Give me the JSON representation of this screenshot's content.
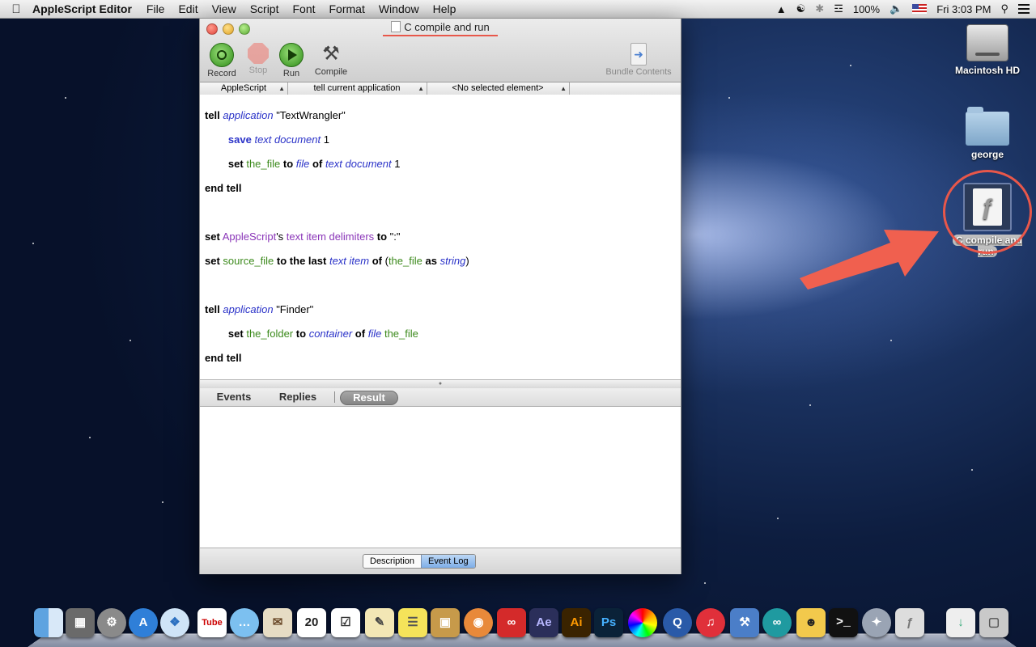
{
  "menubar": {
    "app_name": "AppleScript Editor",
    "menus": [
      "File",
      "Edit",
      "View",
      "Script",
      "Font",
      "Format",
      "Window",
      "Help"
    ],
    "battery": "100%",
    "clock": "Fri 3:03 PM"
  },
  "window": {
    "title": "C compile and run",
    "toolbar": {
      "record": "Record",
      "stop": "Stop",
      "run": "Run",
      "compile": "Compile",
      "bundle": "Bundle Contents"
    },
    "nav": {
      "language": "AppleScript",
      "target": "tell current application",
      "element": "<No selected element>"
    },
    "tabs": {
      "events": "Events",
      "replies": "Replies",
      "result": "Result"
    },
    "bottom": {
      "description": "Description",
      "event_log": "Event Log"
    }
  },
  "desktop": {
    "hd": "Macintosh HD",
    "folder": "george",
    "script_file": "C compile and run"
  },
  "dock": {
    "items": [
      "Finder",
      "Dashboard",
      "System Preferences",
      "App Store",
      "Safari",
      "iTube",
      "Messages",
      "Mail",
      "Calendar",
      "Reminders",
      "Notes",
      "Stickies",
      "Preview",
      "Blender",
      "Creative Cloud",
      "After Effects",
      "Illustrator",
      "Photoshop",
      "Color Picker",
      "QuickTime",
      "iTunes",
      "Xcode",
      "Arduino",
      "Cyberduck",
      "Terminal",
      "Launchpad",
      "Script Editor",
      "Downloads",
      "Trash"
    ],
    "calendar_day": "20"
  }
}
